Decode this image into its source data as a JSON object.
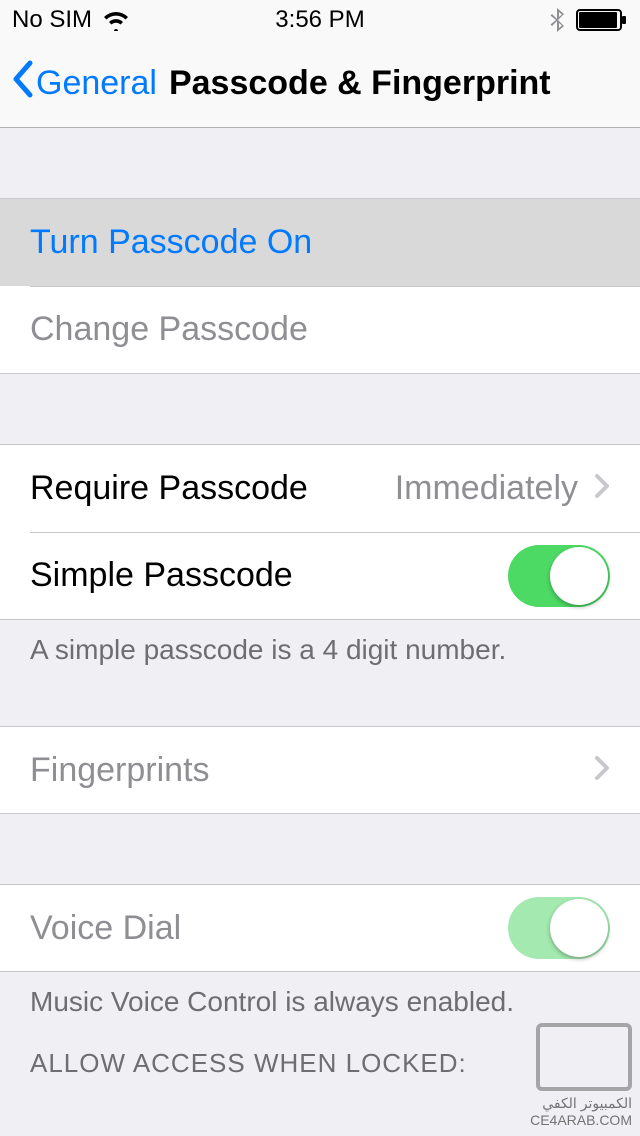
{
  "status": {
    "carrier": "No SIM",
    "time": "3:56 PM"
  },
  "nav": {
    "back": "General",
    "title": "Passcode & Fingerprint"
  },
  "cells": {
    "turn_on": "Turn Passcode On",
    "change": "Change Passcode",
    "require_label": "Require Passcode",
    "require_value": "Immediately",
    "simple_label": "Simple Passcode",
    "simple_footer": "A simple passcode is a 4 digit number.",
    "fingerprints": "Fingerprints",
    "voice_dial": "Voice Dial",
    "voice_footer": "Music Voice Control is always enabled.",
    "allow_header": "ALLOW ACCESS WHEN LOCKED:"
  },
  "watermark": {
    "line1": "الكمبيوتر الكفي",
    "line2": "CE4ARAB.COM"
  }
}
